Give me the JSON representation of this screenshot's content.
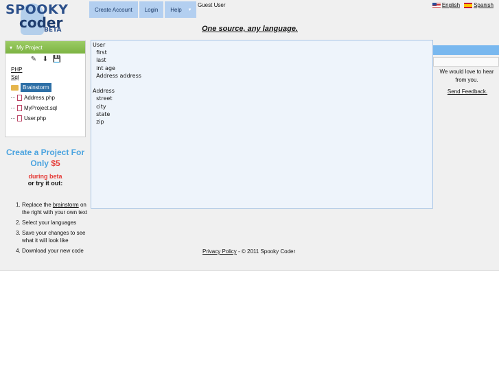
{
  "logo": {
    "line1": "SPOOKY",
    "line2": "coder",
    "badge": "BETA"
  },
  "nav": {
    "create_account": "Create Account",
    "login": "Login",
    "help": "Help",
    "help_caret": "▾"
  },
  "user": {
    "status": "Guest User"
  },
  "languages": [
    {
      "label": "English",
      "flag": "flag-us-icon"
    },
    {
      "label": "Spanish",
      "flag": "flag-es-icon"
    }
  ],
  "tagline": "One source, any language.",
  "project": {
    "title": "My Project",
    "collapse_glyph": "▾",
    "toolbar": [
      {
        "icon": "edit-icon",
        "glyph": "✎"
      },
      {
        "icon": "download-icon",
        "glyph": "⬇"
      },
      {
        "icon": "save-icon",
        "glyph": "💾"
      }
    ],
    "languages": [
      "PHP",
      "Sql"
    ],
    "tree": [
      {
        "label": "Brainstorm",
        "type": "folder",
        "selected": true
      },
      {
        "label": "Address.php",
        "type": "file"
      },
      {
        "label": "MyProject.sql",
        "type": "file"
      },
      {
        "label": "User.php",
        "type": "file"
      }
    ]
  },
  "promo": {
    "line1": "Create a Project For",
    "only": "Only",
    "price": "$5",
    "during": "during beta",
    "try": "or try it out:"
  },
  "steps": [
    {
      "pre": "Replace the ",
      "link": "brainstorm",
      "post": " on the right with your own text"
    },
    {
      "pre": "Select your languages",
      "link": "",
      "post": ""
    },
    {
      "pre": "Save your changes to see what it will look like",
      "link": "",
      "post": ""
    },
    {
      "pre": "Download your new code",
      "link": "",
      "post": ""
    }
  ],
  "editor": {
    "content": "User\n  first\n  last\n  int age\n  Address address\n\nAddress\n  street\n  city\n  state\n  zip"
  },
  "feedback": {
    "text": "We would love to hear from you.",
    "link": "Send Feedback."
  },
  "footer": {
    "privacy": "Privacy Policy",
    "copyright": " - © 2011 Spooky Coder"
  }
}
